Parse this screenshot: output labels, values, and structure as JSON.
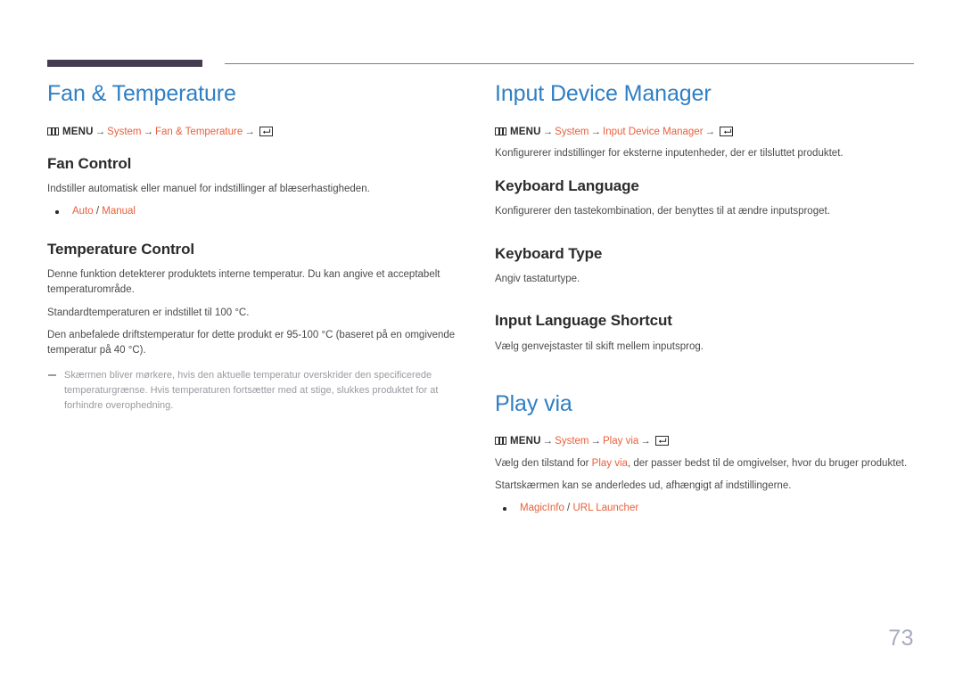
{
  "page": {
    "number": "73",
    "accent_blue": "#2f7fc4",
    "accent_orange": "#e8603c",
    "rule_color": "#453c52",
    "note_color": "#9a9aa2"
  },
  "icons": {
    "menu": "menu-grid-icon",
    "enter": "enter-key-icon"
  },
  "left_column": {
    "title": "Fan & Temperature",
    "menu_path": {
      "menu_label": "MENU",
      "arrow": "→",
      "items": [
        "System",
        "Fan & Temperature"
      ]
    },
    "sections": [
      {
        "heading": "Fan Control",
        "paragraphs": [
          "Indstiller automatisk eller manuel for indstillinger af blæserhastigheden."
        ],
        "bullets": [
          {
            "option_a": "Auto",
            "separator": " / ",
            "option_b": "Manual"
          }
        ]
      },
      {
        "heading": "Temperature Control",
        "paragraphs": [
          "Denne funktion detekterer produktets interne temperatur. Du kan angive et acceptabelt temperaturområde.",
          "Standardtemperaturen er indstillet til 100 °C.",
          "Den anbefalede driftstemperatur for dette produkt er 95-100 °C (baseret på en omgivende temperatur på 40 °C)."
        ],
        "note": "Skærmen bliver mørkere, hvis den aktuelle temperatur overskrider den specificerede temperaturgrænse. Hvis temperaturen fortsætter med at stige, slukkes produktet for at forhindre overophedning."
      }
    ]
  },
  "right_column": {
    "section_one": {
      "title": "Input Device Manager",
      "menu_path": {
        "menu_label": "MENU",
        "arrow": "→",
        "items": [
          "System",
          "Input Device Manager"
        ]
      },
      "intro": "Konfigurerer indstillinger for eksterne inputenheder, der er tilsluttet produktet.",
      "sections": [
        {
          "heading": "Keyboard Language",
          "paragraph": "Konfigurerer den tastekombination, der benyttes til at ændre inputsproget."
        },
        {
          "heading": "Keyboard Type",
          "paragraph": "Angiv tastaturtype."
        },
        {
          "heading": "Input Language Shortcut",
          "paragraph": "Vælg genvejstaster til skift mellem inputsprog."
        }
      ]
    },
    "section_two": {
      "title": "Play via",
      "menu_path": {
        "menu_label": "MENU",
        "arrow": "→",
        "items": [
          "System",
          "Play via"
        ]
      },
      "paragraph_1_before": "Vælg den tilstand for ",
      "paragraph_1_link": "Play via",
      "paragraph_1_after": ", der passer bedst til de omgivelser, hvor du bruger produktet.",
      "paragraph_2": "Startskærmen kan se anderledes ud, afhængigt af indstillingerne.",
      "bullets": [
        {
          "option_a": "MagicInfo",
          "separator": " / ",
          "option_b": "URL Launcher"
        }
      ]
    }
  }
}
